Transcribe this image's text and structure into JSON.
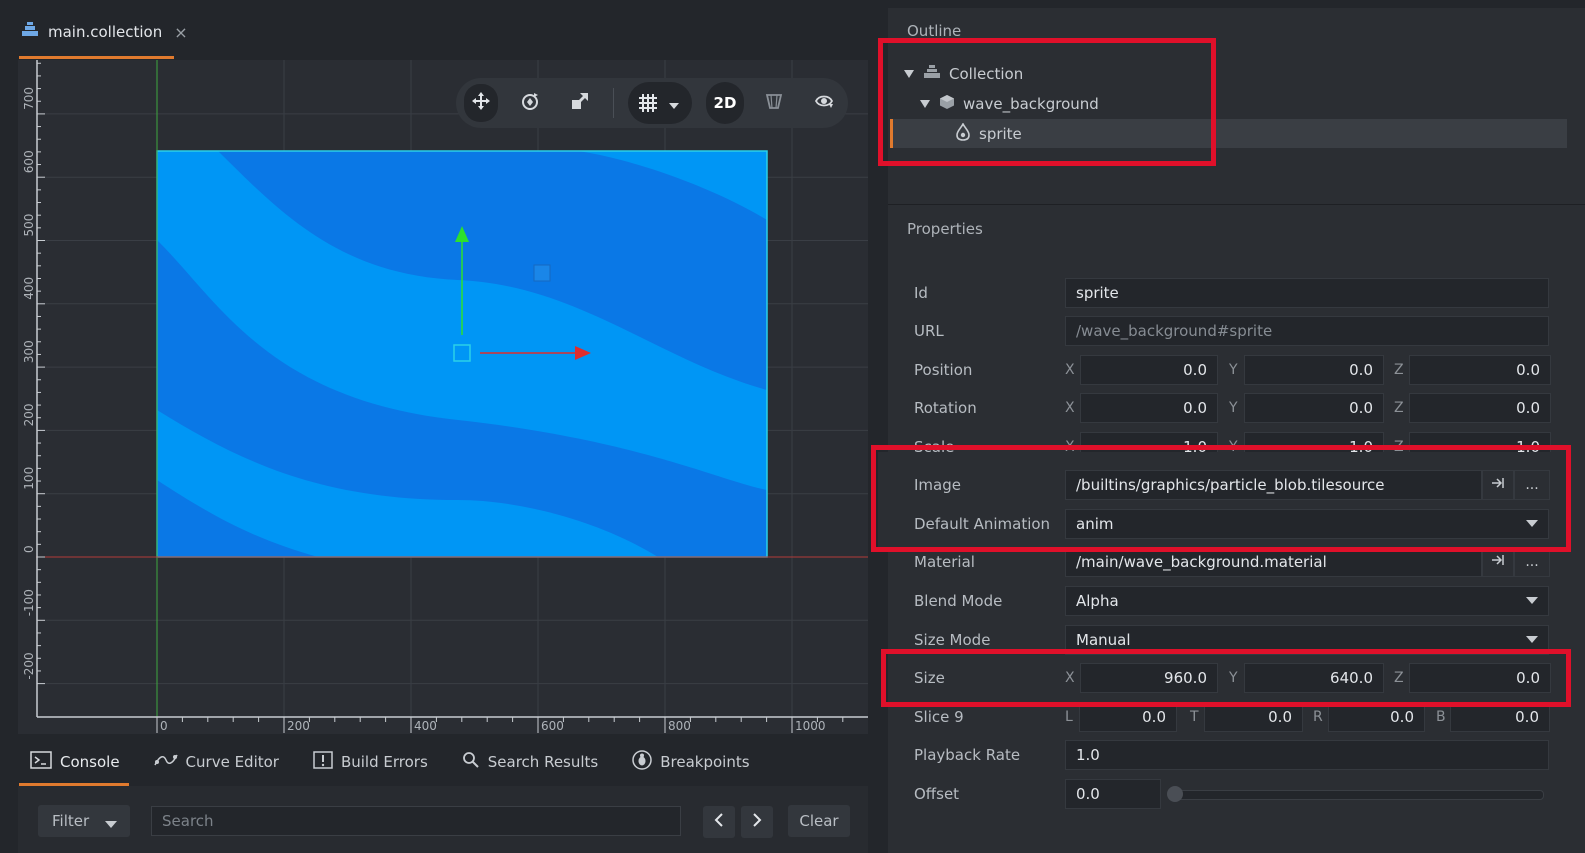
{
  "editor": {
    "tab_label": "main.collection",
    "tab_close": "×",
    "toolbar": {
      "mode_label": "2D"
    }
  },
  "scene": {
    "y_ticks": [
      "700",
      "600",
      "500",
      "400",
      "300",
      "200",
      "100",
      "0",
      "-100",
      "-200"
    ],
    "x_ticks": [
      "0",
      "200",
      "400",
      "600",
      "800",
      "1000"
    ],
    "colors": {
      "light": "#0096f5",
      "dark": "#0a78e6",
      "background": "#2a2d33",
      "grid": "#3a3e45"
    }
  },
  "console": {
    "tabs": [
      {
        "label": "Console",
        "icon": "console-icon"
      },
      {
        "label": "Curve Editor",
        "icon": "curve-icon"
      },
      {
        "label": "Build Errors",
        "icon": "warning-icon"
      },
      {
        "label": "Search Results",
        "icon": "search-icon"
      },
      {
        "label": "Breakpoints",
        "icon": "bug-icon"
      }
    ],
    "filter_label": "Filter",
    "search_placeholder": "Search",
    "clear_label": "Clear"
  },
  "outline": {
    "title": "Outline",
    "items": [
      {
        "label": "Collection"
      },
      {
        "label": "wave_background"
      },
      {
        "label": "sprite"
      }
    ]
  },
  "properties": {
    "title": "Properties",
    "id_label": "Id",
    "id_value": "sprite",
    "url_label": "URL",
    "url_value": "/wave_background#sprite",
    "position_label": "Position",
    "position": [
      "0.0",
      "0.0",
      "0.0"
    ],
    "rotation_label": "Rotation",
    "rotation": [
      "0.0",
      "0.0",
      "0.0"
    ],
    "scale_label": "Scale",
    "scale": [
      "1.0",
      "1.0",
      "1.0"
    ],
    "image_label": "Image",
    "image_value": "/builtins/graphics/particle_blob.tilesource",
    "default_animation_label": "Default Animation",
    "default_animation_value": "anim",
    "material_label": "Material",
    "material_value": "/main/wave_background.material",
    "blend_mode_label": "Blend Mode",
    "blend_mode_value": "Alpha",
    "size_mode_label": "Size Mode",
    "size_mode_value": "Manual",
    "size_label": "Size",
    "size": [
      "960.0",
      "640.0",
      "0.0"
    ],
    "slice9_label": "Slice 9",
    "slice9": [
      "0.0",
      "0.0",
      "0.0",
      "0.0"
    ],
    "playback_rate_label": "Playback Rate",
    "playback_rate_value": "1.0",
    "offset_label": "Offset",
    "offset_value": "0.0",
    "axes_xyz": [
      "X",
      "Y",
      "Z"
    ],
    "axes_ltrb": [
      "L",
      "T",
      "R",
      "B"
    ],
    "browse_label": "..."
  }
}
